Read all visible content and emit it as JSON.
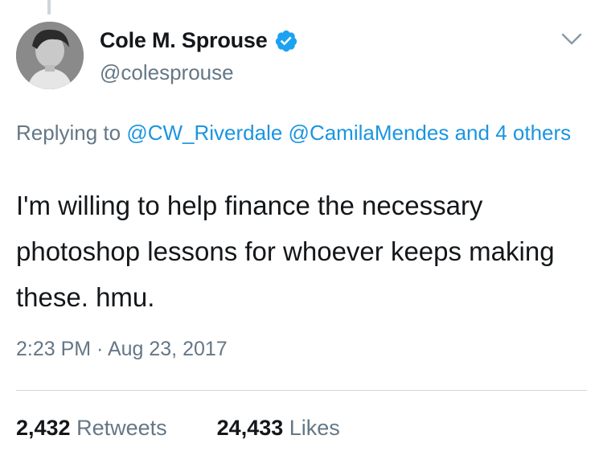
{
  "author": {
    "display_name": "Cole M. Sprouse",
    "handle": "@colesprouse",
    "verified": true
  },
  "reply": {
    "prefix": "Replying to",
    "mentions": [
      "@CW_Riverdale",
      "@CamilaMendes"
    ],
    "others_text": "and 4 others"
  },
  "tweet": {
    "text": "I'm willing to help finance the necessary photoshop lessons for whoever keeps making these. hmu."
  },
  "meta": {
    "timestamp": "2:23 PM · Aug 23, 2017"
  },
  "stats": {
    "retweets_count": "2,432",
    "retweets_label": "Retweets",
    "likes_count": "24,433",
    "likes_label": "Likes"
  },
  "icons": {
    "verified": "verified-badge-icon",
    "menu": "chevron-down-icon"
  },
  "colors": {
    "link": "#1b95e0",
    "secondary_text": "#657786",
    "verified": "#1da1f2"
  }
}
